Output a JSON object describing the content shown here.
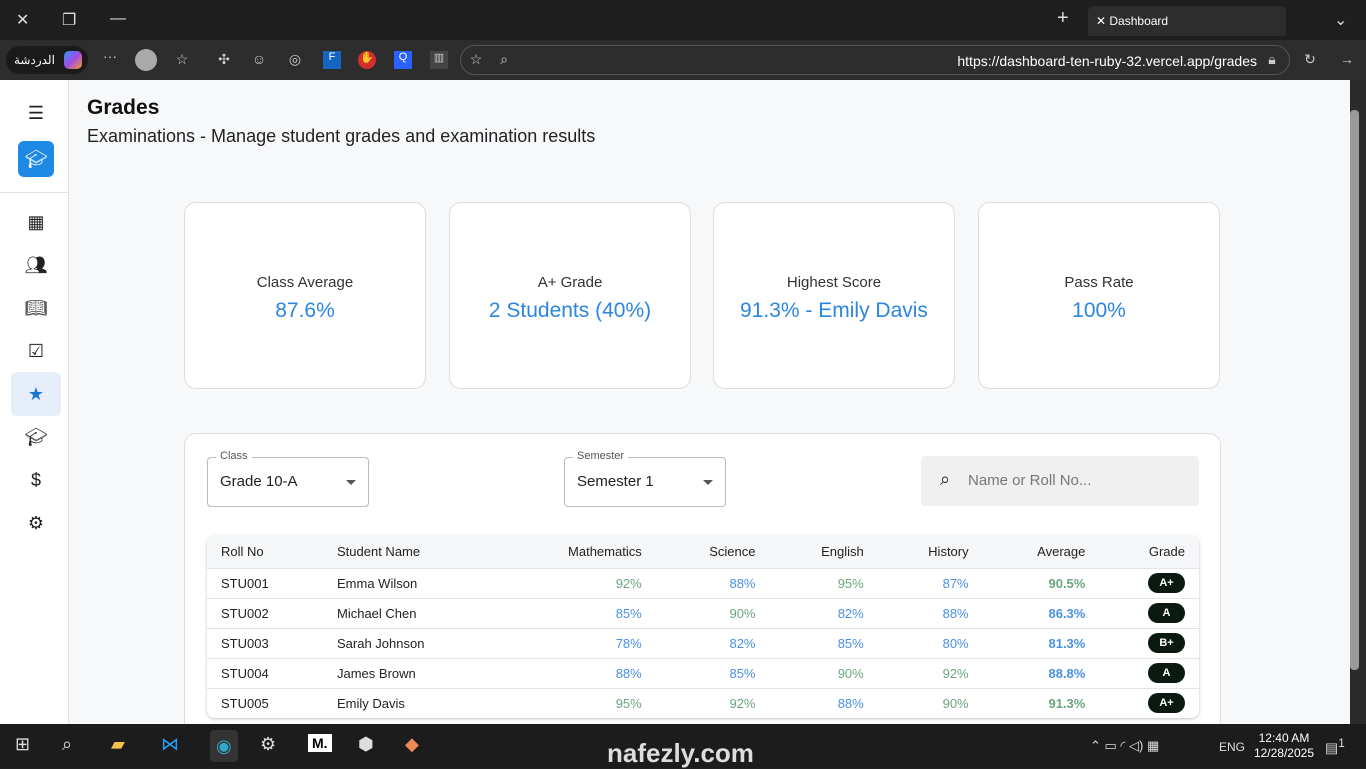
{
  "browser": {
    "tab_title": "Dashboard",
    "url": "https://dashboard-ten-ruby-32.vercel.app/grades",
    "chat_label": "الدردشة"
  },
  "sidebar": {
    "items": [
      {
        "icon": "dashboard-icon"
      },
      {
        "icon": "people-icon"
      },
      {
        "icon": "book-icon"
      },
      {
        "icon": "calendar-check-icon"
      },
      {
        "icon": "star-icon",
        "active": true
      },
      {
        "icon": "graduation-cap-icon"
      },
      {
        "icon": "dollar-icon"
      },
      {
        "icon": "gear-icon"
      }
    ]
  },
  "header": {
    "title": "Grades",
    "subtitle": "Examinations - Manage student grades and examination results"
  },
  "stats": [
    {
      "label": "Class Average",
      "value": "87.6%"
    },
    {
      "label": "A+ Grade",
      "value": "2 Students (40%)"
    },
    {
      "label": "Highest Score",
      "value": "91.3% - Emily Davis"
    },
    {
      "label": "Pass Rate",
      "value": "100%"
    }
  ],
  "filters": {
    "class_label": "Class",
    "class_value": "Grade 10-A",
    "semester_label": "Semester",
    "semester_value": "Semester 1",
    "search_placeholder": "Name or Roll No..."
  },
  "table": {
    "headers": [
      "Roll No",
      "Student Name",
      "Mathematics",
      "Science",
      "English",
      "History",
      "Average",
      "Grade"
    ],
    "rows": [
      [
        "STU001",
        "Emma Wilson",
        "92%",
        "88%",
        "95%",
        "87%",
        "90.5%",
        "A+"
      ],
      [
        "STU002",
        "Michael Chen",
        "85%",
        "90%",
        "82%",
        "88%",
        "86.3%",
        "A"
      ],
      [
        "STU003",
        "Sarah Johnson",
        "78%",
        "82%",
        "85%",
        "80%",
        "81.3%",
        "B+"
      ],
      [
        "STU004",
        "James Brown",
        "88%",
        "85%",
        "90%",
        "92%",
        "88.8%",
        "A"
      ],
      [
        "STU005",
        "Emily Davis",
        "95%",
        "92%",
        "88%",
        "90%",
        "91.3%",
        "A+"
      ]
    ]
  },
  "colors": {
    "accent": "#2a86e0",
    "high_score": "#6aa67f",
    "score": "#4a90e2",
    "badge": "#0b1a10"
  },
  "taskbar": {
    "time": "12:40 AM",
    "date": "12/28/2025",
    "lang": "ENG",
    "notifications": "1"
  },
  "watermark": "nafezly.com"
}
